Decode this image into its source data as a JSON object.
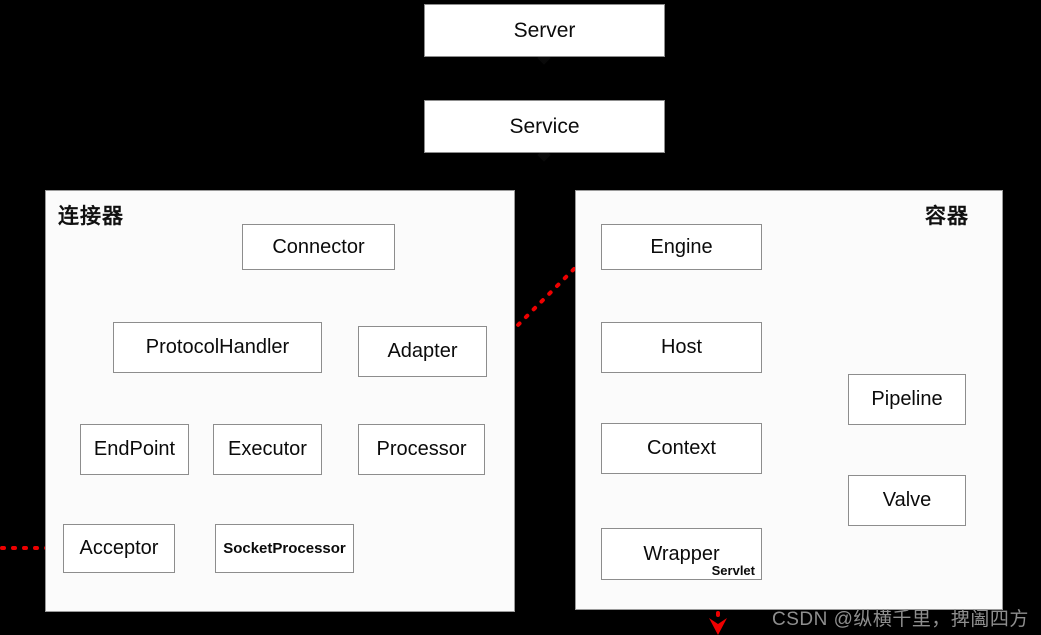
{
  "diagram": {
    "title_server": "Server",
    "title_service": "Service",
    "panels": {
      "connector": {
        "label": "连接器",
        "nodes": {
          "connector": "Connector",
          "protocol_handler": "ProtocolHandler",
          "adapter": "Adapter",
          "endpoint": "EndPoint",
          "executor": "Executor",
          "processor": "Processor",
          "acceptor": "Acceptor",
          "socket_processor": "SocketProcessor"
        }
      },
      "container": {
        "label": "容器",
        "nodes": {
          "engine": "Engine",
          "host": "Host",
          "context": "Context",
          "wrapper": "Wrapper",
          "wrapper_sub": "Servlet",
          "pipeline": "Pipeline",
          "valve": "Valve"
        }
      }
    },
    "watermark": "CSDN @纵横千里，捭阖四方",
    "colors": {
      "background": "#000000",
      "panel_fill": "#fbfbfb",
      "node_fill": "#ffffff",
      "border": "#8d8d8d",
      "edge_solid": "#000000",
      "edge_flow": "#ee0000",
      "text": "#0b0b0b",
      "watermark": "#8e8e8e"
    }
  }
}
